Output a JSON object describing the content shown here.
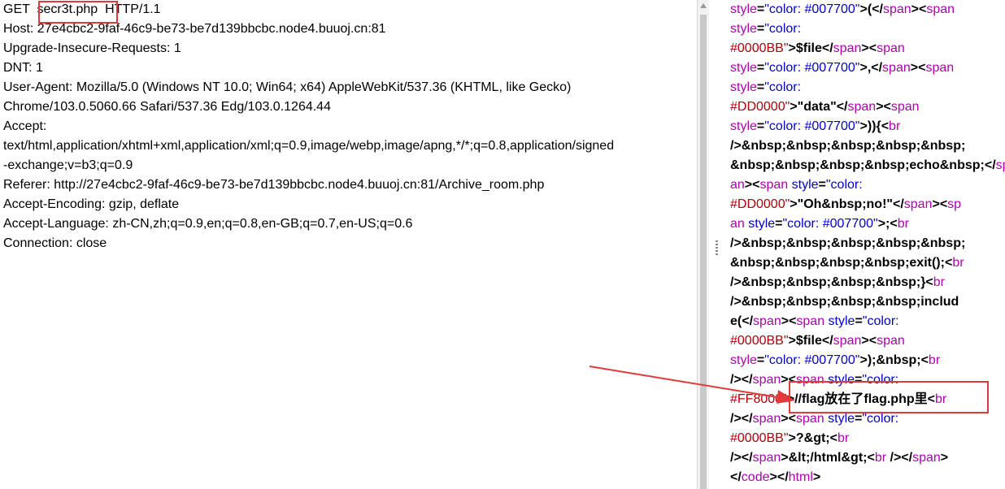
{
  "request": {
    "lines": [
      "GET  secr3t.php  HTTP/1.1",
      "Host: 27e4cbc2-9faf-46c9-be73-be7d139bbcbc.node4.buuoj.cn:81",
      "Upgrade-Insecure-Requests: 1",
      "DNT: 1",
      "User-Agent: Mozilla/5.0 (Windows NT 10.0; Win64; x64) AppleWebKit/537.36 (KHTML, like Gecko)",
      "Chrome/103.0.5060.66 Safari/537.36 Edg/103.0.1264.44",
      "Accept:",
      "text/html,application/xhtml+xml,application/xml;q=0.9,image/webp,image/apng,*/*;q=0.8,application/signed",
      "-exchange;v=b3;q=0.9",
      "Referer: http://27e4cbc2-9faf-46c9-be73-be7d139bbcbc.node4.buuoj.cn:81/Archive_room.php",
      "Accept-Encoding: gzip, deflate",
      "Accept-Language: zh-CN,zh;q=0.9,en;q=0.8,en-GB;q=0.7,en-US;q=0.6",
      "Connection: close"
    ]
  },
  "response": {
    "lines": [
      [
        {
          "t": "style",
          "c": "purple"
        },
        {
          "t": "=",
          "c": "dark"
        },
        {
          "t": "\"color: #007700\"",
          "c": "blue"
        },
        {
          "t": ">(</",
          "c": "dark"
        },
        {
          "t": "span",
          "c": "purple"
        },
        {
          "t": "><",
          "c": "dark"
        },
        {
          "t": "span",
          "c": "purple"
        }
      ],
      [
        {
          "t": "style",
          "c": "purple"
        },
        {
          "t": "=",
          "c": "dark"
        },
        {
          "t": "\"color:",
          "c": "blue"
        }
      ],
      [
        {
          "t": "#0000BB\"",
          "c": "red"
        },
        {
          "t": ">$file</",
          "c": "dark"
        },
        {
          "t": "span",
          "c": "purple"
        },
        {
          "t": "><",
          "c": "dark"
        },
        {
          "t": "span",
          "c": "purple"
        }
      ],
      [
        {
          "t": "style",
          "c": "purple"
        },
        {
          "t": "=",
          "c": "dark"
        },
        {
          "t": "\"color: #007700\"",
          "c": "blue"
        },
        {
          "t": ">,</",
          "c": "dark"
        },
        {
          "t": "span",
          "c": "purple"
        },
        {
          "t": "><",
          "c": "dark"
        },
        {
          "t": "span",
          "c": "purple"
        }
      ],
      [
        {
          "t": "style",
          "c": "purple"
        },
        {
          "t": "=",
          "c": "dark"
        },
        {
          "t": "\"color:",
          "c": "blue"
        }
      ],
      [
        {
          "t": "#DD0000\"",
          "c": "red"
        },
        {
          "t": ">\"data\"</",
          "c": "dark"
        },
        {
          "t": "span",
          "c": "purple"
        },
        {
          "t": "><",
          "c": "dark"
        },
        {
          "t": "span",
          "c": "purple"
        }
      ],
      [
        {
          "t": "style",
          "c": "purple"
        },
        {
          "t": "=",
          "c": "dark"
        },
        {
          "t": "\"color: #007700\"",
          "c": "blue"
        },
        {
          "t": ">)){<",
          "c": "dark"
        },
        {
          "t": "br",
          "c": "purple"
        }
      ],
      [
        {
          "t": "/>&nbsp;&nbsp;&nbsp;&nbsp;&nbsp;",
          "c": "dark"
        }
      ],
      [
        {
          "t": "&nbsp;&nbsp;&nbsp;&nbsp;echo&nbsp;</",
          "c": "dark"
        },
        {
          "t": "sp",
          "c": "purple"
        }
      ],
      [
        {
          "t": "an",
          "c": "purple"
        },
        {
          "t": "><",
          "c": "dark"
        },
        {
          "t": "span",
          "c": "purple"
        },
        {
          "t": " style",
          "c": "blue"
        },
        {
          "t": "=",
          "c": "dark"
        },
        {
          "t": "\"color:",
          "c": "blue"
        }
      ],
      [
        {
          "t": "#DD0000\"",
          "c": "red"
        },
        {
          "t": ">\"Oh&nbsp;no!\"</",
          "c": "dark"
        },
        {
          "t": "span",
          "c": "purple"
        },
        {
          "t": "><",
          "c": "dark"
        },
        {
          "t": "sp",
          "c": "purple"
        }
      ],
      [
        {
          "t": "an",
          "c": "purple"
        },
        {
          "t": " style",
          "c": "blue"
        },
        {
          "t": "=",
          "c": "dark"
        },
        {
          "t": "\"color: #007700\"",
          "c": "blue"
        },
        {
          "t": ">;<",
          "c": "dark"
        },
        {
          "t": "br",
          "c": "purple"
        }
      ],
      [
        {
          "t": "/>&nbsp;&nbsp;&nbsp;&nbsp;&nbsp;",
          "c": "dark"
        }
      ],
      [
        {
          "t": "&nbsp;&nbsp;&nbsp;&nbsp;exit();<",
          "c": "dark"
        },
        {
          "t": "br",
          "c": "purple"
        }
      ],
      [
        {
          "t": "/>&nbsp;&nbsp;&nbsp;&nbsp;}<",
          "c": "dark"
        },
        {
          "t": "br",
          "c": "purple"
        }
      ],
      [
        {
          "t": "/>&nbsp;&nbsp;&nbsp;&nbsp;includ",
          "c": "dark"
        }
      ],
      [
        {
          "t": "e(</",
          "c": "dark"
        },
        {
          "t": "span",
          "c": "purple"
        },
        {
          "t": "><",
          "c": "dark"
        },
        {
          "t": "span",
          "c": "purple"
        },
        {
          "t": " style",
          "c": "blue"
        },
        {
          "t": "=",
          "c": "dark"
        },
        {
          "t": "\"color:",
          "c": "blue"
        }
      ],
      [
        {
          "t": "#0000BB\"",
          "c": "red"
        },
        {
          "t": ">$file</",
          "c": "dark"
        },
        {
          "t": "span",
          "c": "purple"
        },
        {
          "t": "><",
          "c": "dark"
        },
        {
          "t": "span",
          "c": "purple"
        }
      ],
      [
        {
          "t": "style",
          "c": "purple"
        },
        {
          "t": "=",
          "c": "dark"
        },
        {
          "t": "\"color: #007700\"",
          "c": "blue"
        },
        {
          "t": ">);&nbsp;<",
          "c": "dark"
        },
        {
          "t": "br",
          "c": "purple"
        }
      ],
      [
        {
          "t": "/></",
          "c": "dark"
        },
        {
          "t": "span",
          "c": "purple"
        },
        {
          "t": "><",
          "c": "dark"
        },
        {
          "t": "span",
          "c": "purple"
        },
        {
          "t": " style",
          "c": "blue"
        },
        {
          "t": "=",
          "c": "dark"
        },
        {
          "t": "\"color:",
          "c": "blue"
        }
      ],
      [
        {
          "t": "#FF8000\"",
          "c": "red"
        },
        {
          "t": ">//flag放在了flag.php里<",
          "c": "dark"
        },
        {
          "t": "br",
          "c": "purple"
        }
      ],
      [
        {
          "t": "/></",
          "c": "dark"
        },
        {
          "t": "span",
          "c": "purple"
        },
        {
          "t": "><",
          "c": "dark"
        },
        {
          "t": "span",
          "c": "purple"
        },
        {
          "t": " style",
          "c": "blue"
        },
        {
          "t": "=",
          "c": "dark"
        },
        {
          "t": "\"color:",
          "c": "blue"
        }
      ],
      [
        {
          "t": "#0000BB\"",
          "c": "red"
        },
        {
          "t": ">?&gt;<",
          "c": "dark"
        },
        {
          "t": "br",
          "c": "purple"
        }
      ],
      [
        {
          "t": "/></",
          "c": "dark"
        },
        {
          "t": "span",
          "c": "purple"
        },
        {
          "t": ">&lt;/html&gt;<",
          "c": "dark"
        },
        {
          "t": "br",
          "c": "purple"
        },
        {
          "t": " /></",
          "c": "dark"
        },
        {
          "t": "span",
          "c": "purple"
        },
        {
          "t": ">",
          "c": "dark"
        }
      ],
      [
        {
          "t": "</",
          "c": "dark"
        },
        {
          "t": "code",
          "c": "purple"
        },
        {
          "t": "></",
          "c": "dark"
        },
        {
          "t": "html",
          "c": "purple"
        },
        {
          "t": ">",
          "c": "dark"
        }
      ]
    ]
  },
  "colors": {
    "highlight_box": "#e23a3a",
    "tag": "#b000b0",
    "attr": "#0000d0",
    "value": "#b0000a"
  }
}
